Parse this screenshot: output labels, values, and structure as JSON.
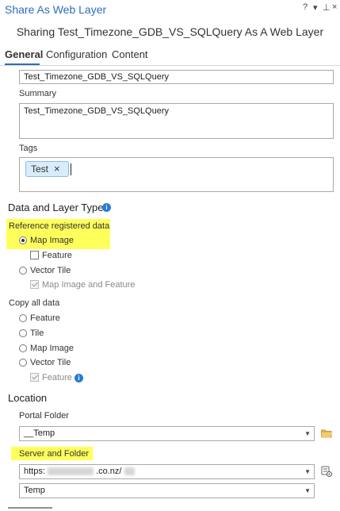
{
  "window": {
    "title": "Share As Web Layer",
    "controls": {
      "help": "?",
      "menu": "▾",
      "pin": "⊥",
      "close": "×"
    }
  },
  "subtitle": "Sharing Test_Timezone_GDB_VS_SQLQuery As A Web Layer",
  "tabs": [
    {
      "label": "General",
      "active": true
    },
    {
      "label": "Configuration",
      "active": false
    },
    {
      "label": "Content",
      "active": false
    }
  ],
  "name_value": "Test_Timezone_GDB_VS_SQLQuery",
  "summary": {
    "label": "Summary",
    "value": "Test_Timezone_GDB_VS_SQLQuery"
  },
  "tags": {
    "label": "Tags",
    "items": [
      "Test"
    ],
    "remove_glyph": "×"
  },
  "data_layer_type": {
    "title": "Data and Layer Type",
    "reference": {
      "label": "Reference registered data",
      "map_image": "Map Image",
      "feature": "Feature",
      "vector_tile": "Vector Tile",
      "map_image_and_feature": "Map Image and Feature"
    },
    "copy": {
      "label": "Copy all data",
      "feature": "Feature",
      "tile": "Tile",
      "map_image": "Map Image",
      "vector_tile": "Vector Tile",
      "feature_sub": "Feature"
    }
  },
  "location": {
    "title": "Location",
    "portal_folder_label": "Portal Folder",
    "portal_folder_value": "__Temp",
    "server_folder_label": "Server and Folder",
    "server_url_prefix": "https:",
    "server_url_suffix": ".co.nz/",
    "server_folder_value": "Temp"
  },
  "icons": {
    "info": "i",
    "dropdown": "▼",
    "folder": "folder-icon",
    "server_settings": "server-settings-icon"
  },
  "colors": {
    "accent": "#2a6ebb",
    "highlight": "#ffff5c",
    "info": "#2a7ad3"
  }
}
